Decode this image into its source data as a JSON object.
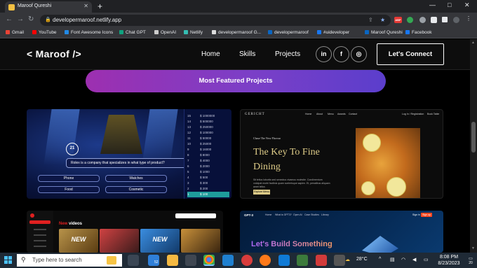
{
  "browser": {
    "tab_title": "Maroof Qureshi",
    "new_tab": "+",
    "url": "developermaroof.netlify.app",
    "window_controls": {
      "minimize": "—",
      "restore": "□",
      "close": "✕"
    },
    "nav": {
      "back": "←",
      "forward": "→",
      "reload": "↻"
    },
    "icons": {
      "lock": "lock-icon",
      "share": "share-icon",
      "bookmark_star": "star-icon",
      "extensions": "puzzle-icon"
    },
    "ext_badge": "ABP",
    "bookmarks": [
      {
        "label": "Gmail",
        "color": "#ea4335"
      },
      {
        "label": "YouTube",
        "color": "#ff0000"
      },
      {
        "label": "Font Awesome Icons",
        "color": "#228ae6"
      },
      {
        "label": "Chat GPT",
        "color": "#10a37f"
      },
      {
        "label": "OpenAI",
        "color": "#cccccc"
      },
      {
        "label": "Netlify",
        "color": "#35bdb2"
      },
      {
        "label": "developermaroof G...",
        "color": "#dddddd"
      },
      {
        "label": "developermaroof",
        "color": "#0a66c2"
      },
      {
        "label": "#uideveloper",
        "color": "#1877f2"
      },
      {
        "label": "Maroof Qureshi",
        "color": "#0a66c2"
      },
      {
        "label": "Facebook",
        "color": "#1877f2"
      }
    ]
  },
  "site": {
    "logo": "< Maroof />",
    "nav": [
      "Home",
      "Skills",
      "Projects"
    ],
    "social": [
      {
        "label": "in",
        "icon": "linkedin-icon"
      },
      {
        "label": "f",
        "icon": "facebook-icon"
      },
      {
        "label": "◎",
        "icon": "instagram-icon"
      }
    ],
    "cta": "Let's Connect",
    "featured_button": "Most Featured Projects"
  },
  "projects": {
    "kbc": {
      "timer": "21",
      "question": "Rolex is a company that specializes in what type of product?",
      "options": [
        "Phone",
        "Watches",
        "Food",
        "Cosmetic"
      ],
      "ladder": [
        {
          "n": "15",
          "amt": "$ 1000000"
        },
        {
          "n": "14",
          "amt": "$ 500000"
        },
        {
          "n": "13",
          "amt": "$ 250000"
        },
        {
          "n": "12",
          "amt": "$ 100000"
        },
        {
          "n": "11",
          "amt": "$ 50000"
        },
        {
          "n": "10",
          "amt": "$ 25000"
        },
        {
          "n": "9",
          "amt": "$ 16000"
        },
        {
          "n": "8",
          "amt": "$ 8000"
        },
        {
          "n": "7",
          "amt": "$ 4000"
        },
        {
          "n": "6",
          "amt": "$ 2000"
        },
        {
          "n": "5",
          "amt": "$ 1000"
        },
        {
          "n": "4",
          "amt": "$ 500"
        },
        {
          "n": "3",
          "amt": "$ 300"
        },
        {
          "n": "2",
          "amt": "$ 200"
        },
        {
          "n": "1",
          "amt": "$ 100"
        }
      ]
    },
    "gericht": {
      "logo": "GERICHT",
      "nav": [
        "Home",
        "About",
        "Menu",
        "Awards",
        "Contact"
      ],
      "nav_right": "Log In / Registration",
      "book": "Book Table",
      "tagline": "Chase The New Flavour",
      "headline": "The Key To Fine Dining",
      "paragraph": "Sit tellus lobortis sed senectus vivamus molestie. Condimentum volutpat morbi facilisis quam scelerisque sapien. Et, penatibus aliquam amet tellus",
      "button": "Explore Menu"
    },
    "youtube": {
      "heading_new": "New",
      "heading_rest": " videos",
      "thumbs": [
        "NEW",
        "",
        "NEW",
        ""
      ]
    },
    "gpt3": {
      "logo": "GPT-3",
      "nav": [
        "Home",
        "What is GPT3?",
        "Open AI",
        "Case Studies",
        "Library"
      ],
      "sign_in": "Sign in",
      "sign_up": "Sign up",
      "headline": "Let's Build Something"
    }
  },
  "taskbar": {
    "search_placeholder": "Type here to search",
    "weather": "28°C",
    "time": "8:08 PM",
    "date": "8/23/2023",
    "notifications": "20",
    "badge": "52"
  }
}
